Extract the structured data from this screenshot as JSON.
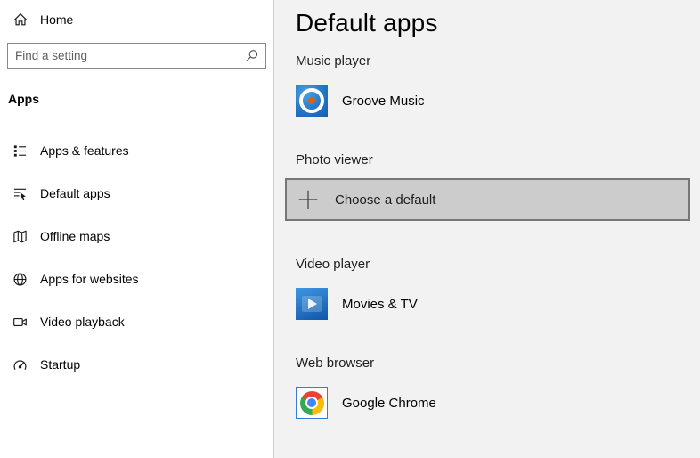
{
  "sidebar": {
    "home": {
      "label": "Home",
      "icon": "home-icon"
    },
    "search": {
      "placeholder": "Find a setting",
      "icon": "search-icon"
    },
    "section_header": "Apps",
    "items": [
      {
        "label": "Apps & features",
        "icon": "apps-features-icon"
      },
      {
        "label": "Default apps",
        "icon": "default-apps-icon"
      },
      {
        "label": "Offline maps",
        "icon": "offline-maps-icon"
      },
      {
        "label": "Apps for websites",
        "icon": "apps-for-websites-icon"
      },
      {
        "label": "Video playback",
        "icon": "video-playback-icon"
      },
      {
        "label": "Startup",
        "icon": "startup-icon"
      }
    ]
  },
  "main": {
    "title": "Default apps",
    "sections": [
      {
        "category": "Music player",
        "app": "Groove Music",
        "icon": "groove-music-icon",
        "type": "app"
      },
      {
        "category": "Photo viewer",
        "app": "Choose a default",
        "icon": "plus-icon",
        "type": "choose-button"
      },
      {
        "category": "Video player",
        "app": "Movies & TV",
        "icon": "movies-tv-icon",
        "type": "app"
      },
      {
        "category": "Web browser",
        "app": "Google Chrome",
        "icon": "chrome-icon",
        "type": "app"
      }
    ]
  },
  "colors": {
    "accent_blue": "#0078d7",
    "content_background": "#f2f2f2",
    "choose_button_bg": "#cccccc",
    "choose_button_border": "#767676",
    "groove_tile_blue": "#2575c6",
    "movies_tile_blue": "#1156a8",
    "chrome_red": "#ea4335",
    "chrome_yellow": "#fbbc05",
    "chrome_green": "#34a853",
    "chrome_blue": "#4285f4"
  }
}
